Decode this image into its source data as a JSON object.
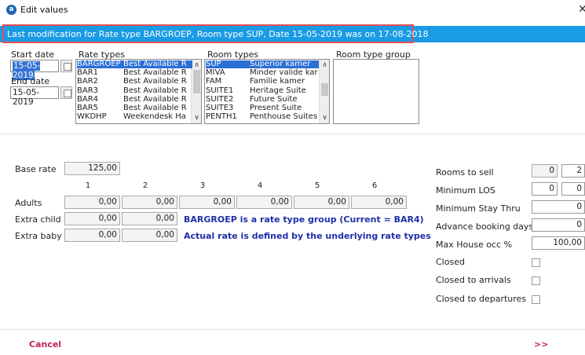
{
  "window": {
    "title": "Edit values",
    "app_icon": "app-logo-icon",
    "close_glyph": "✕"
  },
  "info": {
    "text": "Last modification for Rate type BARGROEP, Room type SUP, Date 15-05-2019 was on 17-08-2018"
  },
  "labels": {
    "start_date": "Start date",
    "end_date": "End date",
    "rate_types": "Rate types",
    "room_types": "Room types",
    "room_type_group": "Room type group",
    "base_rate": "Base rate",
    "adults": "Adults",
    "extra_child": "Extra child",
    "extra_baby": "Extra baby",
    "rooms_to_sell": "Rooms to sell",
    "minimum_los": "Minimum LOS",
    "minimum_stay_thru": "Minimum Stay Thru",
    "advance_booking_days": "Advance booking days",
    "max_house_occ": "Max House occ %",
    "closed": "Closed",
    "closed_to_arrivals": "Closed to arrivals",
    "closed_to_departures": "Closed to departures"
  },
  "dates": {
    "start": "15-05-2019",
    "end": "15-05-2019"
  },
  "rate_types": [
    {
      "code": "BARGROEP",
      "name": "Best Available R",
      "selected": true
    },
    {
      "code": "BAR1",
      "name": "Best Available R",
      "selected": false
    },
    {
      "code": "BAR2",
      "name": "Best Available R",
      "selected": false
    },
    {
      "code": "BAR3",
      "name": "Best Available R",
      "selected": false
    },
    {
      "code": "BAR4",
      "name": "Best Available R",
      "selected": false
    },
    {
      "code": "BAR5",
      "name": "Best Available R",
      "selected": false
    },
    {
      "code": "WKDHP",
      "name": "Weekendesk Ha",
      "selected": false
    }
  ],
  "room_types": [
    {
      "code": "SUP",
      "name": "Superior kamer",
      "selected": true
    },
    {
      "code": "MIVA",
      "name": "Minder valide kar",
      "selected": false
    },
    {
      "code": "FAM",
      "name": "Familie kamer",
      "selected": false
    },
    {
      "code": "SUITE1",
      "name": "Heritage Suite",
      "selected": false
    },
    {
      "code": "SUITE2",
      "name": "Future Suite",
      "selected": false
    },
    {
      "code": "SUITE3",
      "name": "Present Suite",
      "selected": false
    },
    {
      "code": "PENTH1",
      "name": "Penthouse Suites",
      "selected": false
    }
  ],
  "rates": {
    "base_rate": "125,00",
    "columns": [
      "1",
      "2",
      "3",
      "4",
      "5",
      "6"
    ],
    "adults": [
      "0,00",
      "0,00",
      "0,00",
      "0,00",
      "0,00",
      "0,00"
    ],
    "extra_child": [
      "0,00",
      "0,00"
    ],
    "extra_baby": [
      "0,00",
      "0,00"
    ],
    "msg1": "BARGROEP is a rate type group (Current = BAR4)",
    "msg2": "Actual rate is defined by the underlying rate types"
  },
  "restrictions": {
    "rooms_to_sell": [
      "0",
      "2"
    ],
    "minimum_los": [
      "0",
      "0"
    ],
    "minimum_stay_thru": "0",
    "advance_booking_days": "0",
    "max_house_occ": "100,00",
    "closed": false,
    "closed_to_arrivals": false,
    "closed_to_departures": false
  },
  "footer": {
    "cancel": "Cancel",
    "next": ">>"
  },
  "colors": {
    "info_bar": "#1a9be6",
    "selection": "#2b6fd6",
    "message": "#1e2fa8",
    "footer_link": "#c0235a"
  }
}
